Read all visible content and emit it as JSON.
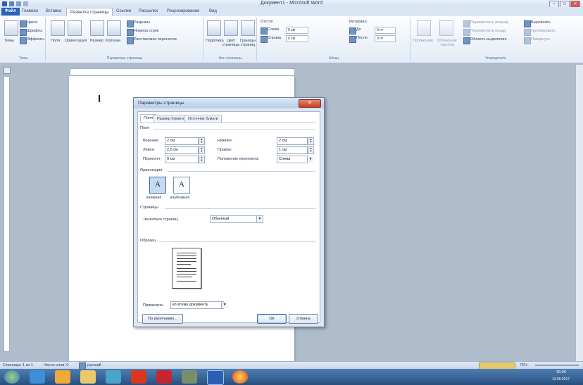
{
  "app": {
    "title": "Документ1 - Microsoft Word"
  },
  "window_controls": {
    "minimize": "–",
    "maximize": "□",
    "close": "✕"
  },
  "tabs": [
    {
      "label": "Файл"
    },
    {
      "label": "Главная"
    },
    {
      "label": "Вставка"
    },
    {
      "label": "Разметка страницы"
    },
    {
      "label": "Ссылки"
    },
    {
      "label": "Рассылки"
    },
    {
      "label": "Рецензирование"
    },
    {
      "label": "Вид"
    }
  ],
  "ribbon": {
    "themes": {
      "themes_label": "Темы",
      "colors": "Цвета",
      "fonts": "Шрифты",
      "effects": "Эффекты",
      "group": "Темы"
    },
    "page_setup": {
      "fields": "Поля",
      "orientation": "Ориентация",
      "size": "Размер",
      "columns": "Колонки",
      "breaks": "Разрывы",
      "line_numbers": "Номера строк",
      "hyphenation": "Расстановка переносов",
      "group": "Параметры страницы"
    },
    "page_background": {
      "watermark": "Подложка",
      "page_color": "Цвет страницы",
      "page_borders": "Границы страниц",
      "group": "Фон страницы"
    },
    "paragraph": {
      "indent": "Отступ",
      "left": "Слева",
      "left_val": "0 см",
      "right": "Справа",
      "right_val": "0 см",
      "spacing": "Интервал",
      "before": "До",
      "before_val": "0 пт",
      "after": "После",
      "after_val": "0 пт",
      "group": "Абзац"
    },
    "arrange": {
      "position": "Положение",
      "wrap": "Обтекание текстом",
      "bring_forward": "Переместить вперед",
      "send_backward": "Переместить назад",
      "selection_pane": "Область выделения",
      "align": "Выровнять",
      "group_btn": "Группировать",
      "rotate": "Повернуть",
      "group": "Упорядочить"
    }
  },
  "dialog": {
    "title": "Параметры страницы",
    "tabs": [
      {
        "label": "Поля"
      },
      {
        "label": "Размер бумаги"
      },
      {
        "label": "Источник бумаги"
      }
    ],
    "margins_section": "Поля",
    "top_label": "Верхнее:",
    "top_value": "2 см",
    "bottom_label": "Нижнее:",
    "bottom_value": "2 см",
    "left_label": "Левое:",
    "left_value": "2,5 см",
    "right_label": "Правое:",
    "right_value": "1 см",
    "gutter_label": "Переплет:",
    "gutter_value": "0 см",
    "gutter_pos_label": "Положение переплета:",
    "gutter_pos_value": "Слева",
    "orientation_section": "Ориентация",
    "portrait": "книжная",
    "landscape": "альбомная",
    "pages_section": "Страницы",
    "multiple_pages_label": "несколько страниц:",
    "multiple_pages_value": "Обычный",
    "preview_section": "Образец",
    "apply_label": "Применить:",
    "apply_value": "ко всему документу",
    "default_button": "По умолчанию...",
    "ok_button": "ОК",
    "cancel_button": "Отмена"
  },
  "status": {
    "page": "Страница: 1 из 1",
    "words": "Число слов: 0",
    "language": "русский",
    "zoom": "75%"
  },
  "taskbar": {
    "time": "15:06",
    "date": "13.09.2017"
  },
  "colors": {
    "accent": "#2a63b8",
    "taskbar": "#27507f",
    "close": "#c3402a"
  }
}
